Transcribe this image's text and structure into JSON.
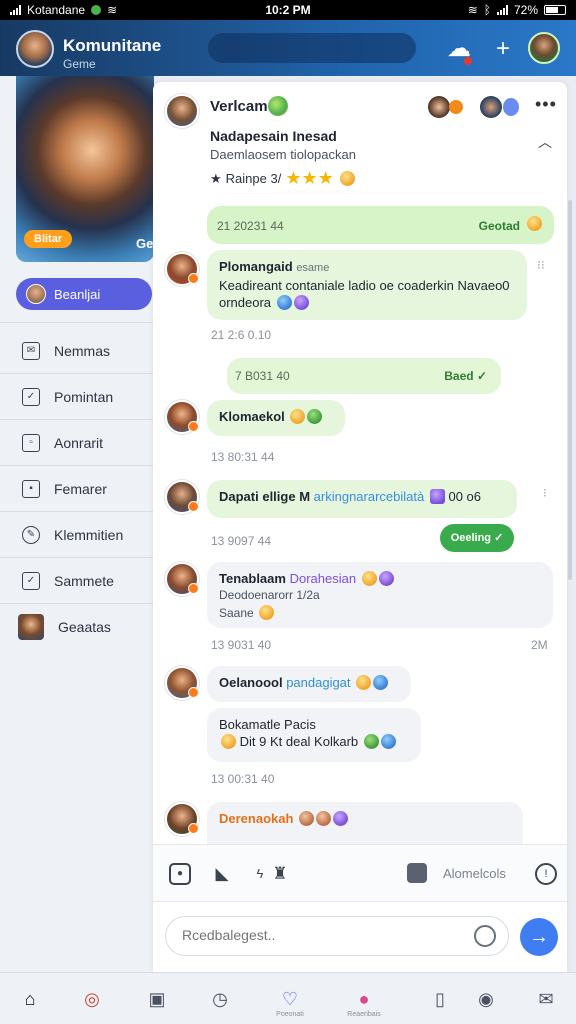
{
  "status_bar": {
    "carrier": "Kotandane",
    "time": "10:2 PM",
    "battery": "72%"
  },
  "header": {
    "title": "Komunitane",
    "subtitle": "Geme"
  },
  "sidebar": {
    "card_badge": "Blitar",
    "card_corner": "Ge",
    "pill_label": "Beanljai",
    "items": [
      {
        "label": "Nemmas"
      },
      {
        "label": "Pomintan"
      },
      {
        "label": "Aonrarit"
      },
      {
        "label": "Femarer"
      },
      {
        "label": "Klemmitien"
      },
      {
        "label": "Sammete"
      },
      {
        "label": "Geaatas"
      }
    ]
  },
  "chat_header": {
    "name": "Verlcam",
    "title": "Nadapesain Inesad",
    "subtitle": "Daemlaosem tiolopackan",
    "rating_label": "Rainpe 3/"
  },
  "messages": [
    {
      "time": "21 20231 44",
      "label": "Geotad"
    },
    {
      "name": "Plomangaid",
      "meta": "esame",
      "text": "Keadireant contaniale ladio oe coaderkin Navaeo0",
      "text2": "orndeora"
    },
    {
      "time": "21 2:6 0.10"
    },
    {
      "time": "7 B031 40",
      "label": "Baed ✓"
    },
    {
      "name": "Klomaekol"
    },
    {
      "time": "13 80:31 44"
    },
    {
      "name": "Dapati ellige M",
      "text": "arkingnararcebilatà",
      "text2": "00 o6"
    },
    {
      "time": "13 9097 44",
      "pill": "Oeeling ✓"
    },
    {
      "name": "Tenablaam",
      "highlight": "Dorahesian",
      "text": "Deodoenarorr 1/2a",
      "text2": "Saane"
    },
    {
      "time": "13 9031 40",
      "right": "2M"
    },
    {
      "name": "Oelanoool",
      "highlight": "pandagigat"
    },
    {
      "name": "Bokamatle Pacis",
      "text": "Dit 9 Kt deal Kolkarb"
    },
    {
      "time": "13 00:31 40"
    },
    {
      "name": "Derenaokah"
    }
  ],
  "actions": {
    "label": "Alomelcols"
  },
  "composer": {
    "placeholder": "Rcedbalegest.."
  },
  "bottom_nav": {
    "labels": [
      "Poeonati",
      "Reaeribais"
    ]
  },
  "colors": {
    "accent": "#3f7df0",
    "bubble_green": "#d7f3c8",
    "bubble_light": "#f1f3f6",
    "sidebar_pill": "#5a5fe0"
  }
}
